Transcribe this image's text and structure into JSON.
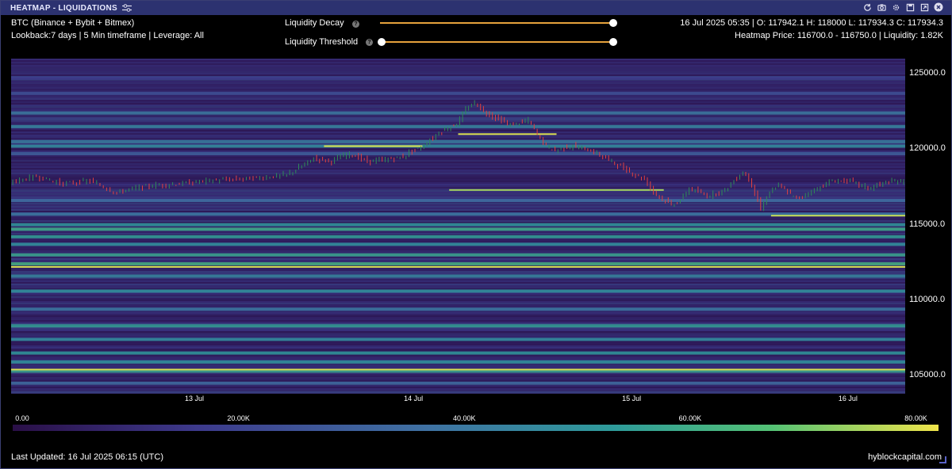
{
  "window": {
    "title": "HEATMAP - LIQUIDATIONS"
  },
  "info": {
    "source": "BTC (Binance + Bybit + Bitmex)",
    "settings": "Lookback:7 days | 5 Min timeframe | Leverage: All",
    "ohlc": "16 Jul 2025 05:35 | O: 117942.1 H: 118000 L: 117934.3 C: 117934.3",
    "heatmap_price": "Heatmap Price: 116700.0 - 116750.0 | Liquidity: 1.82K"
  },
  "controls": {
    "decay_label": "Liquidity Decay",
    "threshold_label": "Liquidity Threshold",
    "help_glyph": "?",
    "decay_value": 1.0,
    "threshold_value": [
      0.0,
      1.0
    ]
  },
  "colors": {
    "background": "#000000",
    "titlebar": "#2c3270",
    "slider_track": "#e6a23c",
    "candle_up": "#2e8b57",
    "candle_down": "#e04040"
  },
  "icons": [
    "settings-sliders-icon",
    "refresh-icon",
    "camera-icon",
    "gear-icon",
    "save-icon",
    "expand-icon",
    "close-icon"
  ],
  "chart_data": {
    "type": "heatmap",
    "x_ticks": [
      "13 Jul",
      "14 Jul",
      "15 Jul",
      "16 Jul"
    ],
    "y_ticks": [
      "125000.0",
      "120000.0",
      "115000.0",
      "110000.0",
      "105000.0"
    ],
    "ylim": [
      103800,
      126000
    ],
    "xlim": [
      0,
      100
    ],
    "colorbar": {
      "ticks": [
        "0.00",
        "20.00K",
        "40.00K",
        "60.00K",
        "80.00K"
      ],
      "range": [
        0,
        82000
      ]
    },
    "price_series": {
      "x": [
        0,
        3,
        6,
        9,
        12,
        13,
        16,
        19,
        22,
        25,
        28,
        31,
        33,
        34,
        35,
        36,
        37,
        38,
        40,
        42,
        44,
        45,
        46,
        47,
        48,
        49,
        50,
        51,
        52,
        53,
        54,
        56,
        58,
        59,
        60,
        61,
        62,
        63,
        65,
        67,
        69,
        71,
        72,
        73,
        74,
        75,
        76,
        78,
        80,
        82,
        83,
        84,
        85,
        86,
        88,
        90,
        92,
        94,
        96,
        98,
        100
      ],
      "y": [
        117800,
        118200,
        117700,
        117900,
        117100,
        117300,
        117600,
        117700,
        117900,
        118000,
        118100,
        118300,
        119000,
        119400,
        119300,
        119200,
        119500,
        119700,
        119200,
        119300,
        119500,
        119900,
        120100,
        120600,
        121100,
        121400,
        121700,
        122600,
        123100,
        122500,
        122200,
        121600,
        121900,
        121000,
        120200,
        119900,
        120100,
        120200,
        119900,
        119300,
        118600,
        118000,
        117200,
        116700,
        116300,
        116600,
        117400,
        116900,
        117300,
        118500,
        117700,
        116000,
        117200,
        117600,
        116700,
        117300,
        117900,
        117900,
        117400,
        117800,
        117900
      ]
    },
    "liquidity_levels": [
      {
        "price": 124700,
        "intensity": 18000
      },
      {
        "price": 123700,
        "intensity": 25000
      },
      {
        "price": 122400,
        "intensity": 40000
      },
      {
        "price": 121500,
        "intensity": 45000
      },
      {
        "price": 120500,
        "intensity": 42000
      },
      {
        "price": 120200,
        "intensity": 48000
      },
      {
        "price": 119700,
        "intensity": 30000
      },
      {
        "price": 116600,
        "intensity": 36000
      },
      {
        "price": 115700,
        "intensity": 40000
      },
      {
        "price": 115000,
        "intensity": 52000
      },
      {
        "price": 114700,
        "intensity": 60000
      },
      {
        "price": 114200,
        "intensity": 55000
      },
      {
        "price": 113700,
        "intensity": 50000
      },
      {
        "price": 113000,
        "intensity": 58000
      },
      {
        "price": 112400,
        "intensity": 62000
      },
      {
        "price": 111600,
        "intensity": 45000
      },
      {
        "price": 110600,
        "intensity": 50000
      },
      {
        "price": 109400,
        "intensity": 40000
      },
      {
        "price": 108300,
        "intensity": 55000
      },
      {
        "price": 107400,
        "intensity": 48000
      },
      {
        "price": 106500,
        "intensity": 52000
      },
      {
        "price": 105900,
        "intensity": 50000
      },
      {
        "price": 105300,
        "intensity": 58000
      },
      {
        "price": 104500,
        "intensity": 35000
      }
    ],
    "highlight_lines": [
      {
        "price": 120200,
        "x_start": 35,
        "x_end": 46,
        "intensity": 80000
      },
      {
        "price": 121000,
        "x_start": 50,
        "x_end": 61,
        "intensity": 80000
      },
      {
        "price": 117300,
        "x_start": 49,
        "x_end": 73,
        "intensity": 75000
      },
      {
        "price": 115600,
        "x_start": 85,
        "x_end": 100,
        "intensity": 78000
      },
      {
        "price": 112200,
        "x_start": 0,
        "x_end": 100,
        "intensity": 80000
      },
      {
        "price": 105400,
        "x_start": 0,
        "x_end": 100,
        "intensity": 80000
      }
    ]
  },
  "footer": {
    "updated": "Last Updated: 16 Jul 2025 06:15 (UTC)",
    "brand": "hyblockcapital.com"
  }
}
